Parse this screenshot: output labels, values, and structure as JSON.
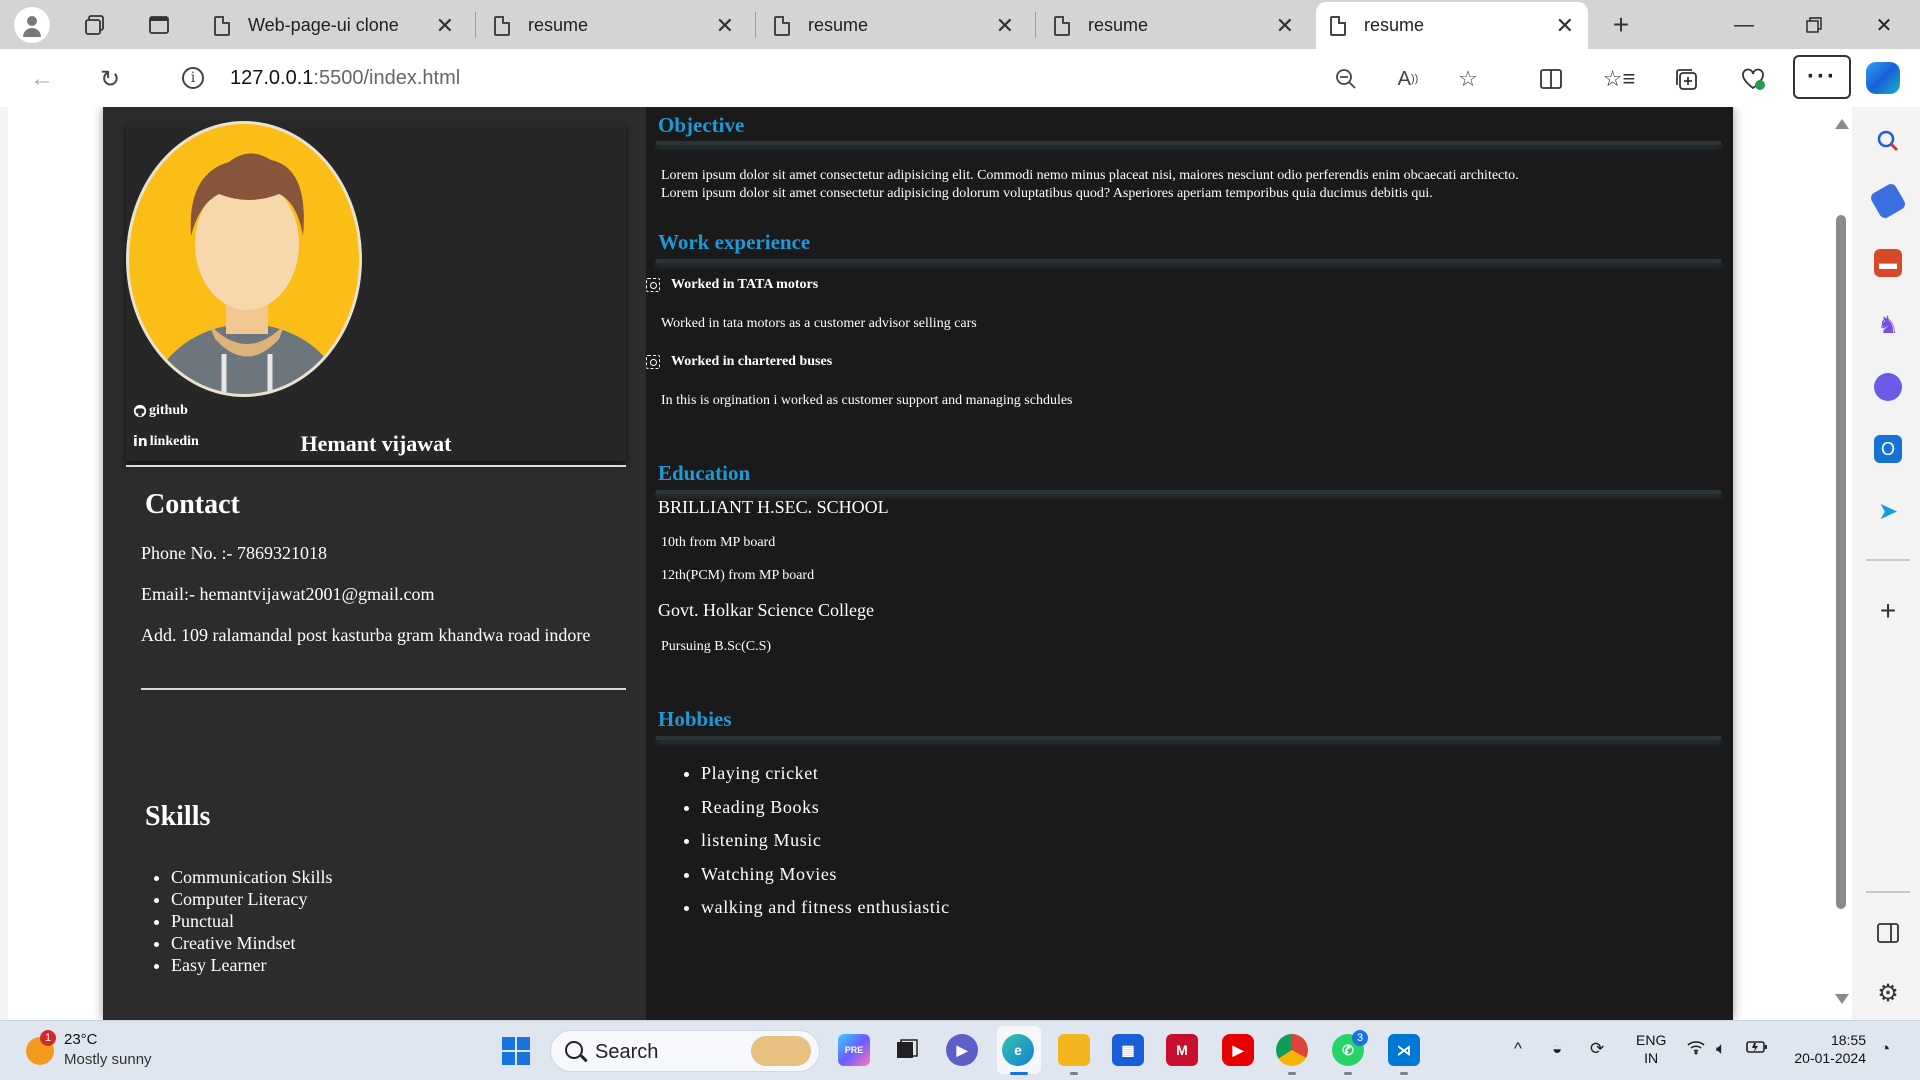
{
  "browser": {
    "tabs": [
      {
        "label": "Web-page-ui clone",
        "active": false
      },
      {
        "label": "resume",
        "active": false
      },
      {
        "label": "resume",
        "active": false
      },
      {
        "label": "resume",
        "active": false
      },
      {
        "label": "resume",
        "active": true
      }
    ],
    "url_host": "127.0.0.1",
    "url_rest": ":5500/index.html"
  },
  "resume": {
    "name": "Hemant vijawat",
    "links": {
      "github": "github",
      "linkedin": "linkedin"
    },
    "contact": {
      "title": "Contact",
      "phone": "Phone No. :- 7869321018",
      "email": "Email:- hemantvijawat2001@gmail.com",
      "address": "Add. 109 ralamandal post kasturba gram khandwa road indore"
    },
    "skills": {
      "title": "Skills",
      "items": [
        "Communication Skills",
        "Computer Literacy",
        "Punctual",
        "Creative Mindset",
        "Easy Learner"
      ]
    },
    "objective": {
      "title": "Objective",
      "line1": "Lorem ipsum dolor sit amet consectetur adipisicing elit. Commodi nemo minus placeat nisi, maiores nesciunt odio perferendis enim obcaecati architecto.",
      "line2": "Lorem ipsum dolor sit amet consectetur adipisicing dolorum voluptatibus quod? Asperiores aperiam temporibus quia ducimus debitis qui."
    },
    "work": {
      "title": "Work experience",
      "jobs": [
        {
          "title": "Worked in TATA motors",
          "desc": "Worked in tata motors as a customer advisor selling cars"
        },
        {
          "title": "Worked in chartered buses",
          "desc": "In this is orgination i worked as customer support and managing schdules"
        }
      ]
    },
    "education": {
      "title": "Education",
      "school1": "BRILLIANT H.SEC. SCHOOL",
      "school1_items": [
        "10th from MP board",
        "12th(PCM) from MP board"
      ],
      "school2": "Govt. Holkar Science College",
      "school2_items": [
        "Pursuing B.Sc(C.S)"
      ]
    },
    "hobbies": {
      "title": "Hobbies",
      "items": [
        "Playing cricket",
        "Reading Books",
        "listening Music",
        "Watching Movies",
        "walking and fitness enthusiastic"
      ]
    }
  },
  "taskbar": {
    "weather_temp": "23°C",
    "weather_desc": "Mostly sunny",
    "weather_badge": "1",
    "search_label": "Search",
    "whatsapp_badge": "3",
    "lang_line1": "ENG",
    "lang_line2": "IN",
    "time": "18:55",
    "date": "20-01-2024"
  },
  "colors": {
    "accent_heading": "#1f9ad6",
    "left_panel": "#2d2c2c",
    "right_panel": "#1a1a1b",
    "avatar_bg": "#fbbe17"
  }
}
